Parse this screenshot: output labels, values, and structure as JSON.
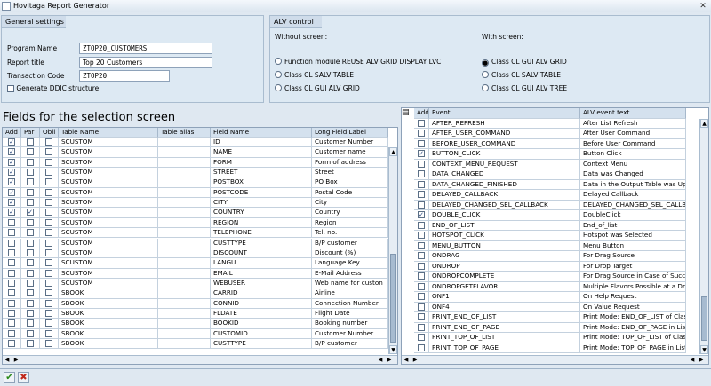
{
  "window": {
    "title": "Hovitaga Report Generator",
    "close": "✕"
  },
  "general": {
    "header": "General settings",
    "program_name_label": "Program Name",
    "program_name_value": "ZTOP20_CUSTOMERS",
    "report_title_label": "Report title",
    "report_title_value": "Top 20 Customers",
    "tcode_label": "Transaction Code",
    "tcode_value": "ZTOP20",
    "ddic_label": "Generate DDIC structure"
  },
  "alv": {
    "header": "ALV control",
    "without_label": "Without screen:",
    "with_label": "With screen:",
    "without_options": [
      "Function module REUSE ALV GRID DISPLAY LVC",
      "Class CL SALV TABLE",
      "Class CL GUI ALV GRID"
    ],
    "with_options": [
      "Class CL GUI ALV GRID",
      "Class CL SALV TABLE",
      "Class CL GUI ALV TREE"
    ],
    "selected": "Class CL GUI ALV GRID"
  },
  "fields": {
    "title": "Fields for the selection screen",
    "columns": [
      "Add",
      "Par",
      "Obli",
      "Table Name",
      "Table alias",
      "Field Name",
      "Long Field Label"
    ],
    "rows": [
      [
        "✓",
        "",
        "",
        "SCUSTOM",
        "",
        "ID",
        "Customer Number"
      ],
      [
        "✓",
        "",
        "",
        "SCUSTOM",
        "",
        "NAME",
        "Customer name"
      ],
      [
        "✓",
        "",
        "",
        "SCUSTOM",
        "",
        "FORM",
        "Form of address"
      ],
      [
        "✓",
        "",
        "",
        "SCUSTOM",
        "",
        "STREET",
        "Street"
      ],
      [
        "✓",
        "",
        "",
        "SCUSTOM",
        "",
        "POSTBOX",
        "PO Box"
      ],
      [
        "✓",
        "",
        "",
        "SCUSTOM",
        "",
        "POSTCODE",
        "Postal Code"
      ],
      [
        "✓",
        "",
        "",
        "SCUSTOM",
        "",
        "CITY",
        "City"
      ],
      [
        "✓",
        "✓",
        "",
        "SCUSTOM",
        "",
        "COUNTRY",
        "Country"
      ],
      [
        "",
        "",
        "",
        "SCUSTOM",
        "",
        "REGION",
        "Region"
      ],
      [
        "",
        "",
        "",
        "SCUSTOM",
        "",
        "TELEPHONE",
        "Tel. no."
      ],
      [
        "",
        "",
        "",
        "SCUSTOM",
        "",
        "CUSTTYPE",
        "B/P customer"
      ],
      [
        "",
        "",
        "",
        "SCUSTOM",
        "",
        "DISCOUNT",
        "Discount (%)"
      ],
      [
        "",
        "",
        "",
        "SCUSTOM",
        "",
        "LANGU",
        "Language Key"
      ],
      [
        "",
        "",
        "",
        "SCUSTOM",
        "",
        "EMAIL",
        "E-Mail Address"
      ],
      [
        "",
        "",
        "",
        "SCUSTOM",
        "",
        "WEBUSER",
        "Web name for custon"
      ],
      [
        "",
        "",
        "",
        "SBOOK",
        "",
        "CARRID",
        "Airline"
      ],
      [
        "",
        "",
        "",
        "SBOOK",
        "",
        "CONNID",
        "Connection Number"
      ],
      [
        "",
        "",
        "",
        "SBOOK",
        "",
        "FLDATE",
        "Flight Date"
      ],
      [
        "",
        "",
        "",
        "SBOOK",
        "",
        "BOOKID",
        "Booking number"
      ],
      [
        "",
        "",
        "",
        "SBOOK",
        "",
        "CUSTOMID",
        "Customer Number"
      ],
      [
        "",
        "",
        "",
        "SBOOK",
        "",
        "CUSTTYPE",
        "B/P customer"
      ]
    ]
  },
  "events": {
    "columns": [
      "Add",
      "Event",
      "ALV event text"
    ],
    "rows": [
      [
        "",
        "AFTER_REFRESH",
        "After List Refresh"
      ],
      [
        "",
        "AFTER_USER_COMMAND",
        "After User Command"
      ],
      [
        "",
        "BEFORE_USER_COMMAND",
        "Before User Command"
      ],
      [
        "✓",
        "BUTTON_CLICK",
        "Button Click"
      ],
      [
        "",
        "CONTEXT_MENU_REQUEST",
        "Context Menu"
      ],
      [
        "",
        "DATA_CHANGED",
        "Data was Changed"
      ],
      [
        "",
        "DATA_CHANGED_FINISHED",
        "Data in the Output Table was Upd"
      ],
      [
        "",
        "DELAYED_CALLBACK",
        "Delayed Callback"
      ],
      [
        "",
        "DELAYED_CHANGED_SEL_CALLBACK",
        "DELAYED_CHANGED_SEL_CALLBAC"
      ],
      [
        "✓",
        "DOUBLE_CLICK",
        "DoubleClick"
      ],
      [
        "",
        "END_OF_LIST",
        "End_of_list"
      ],
      [
        "",
        "HOTSPOT_CLICK",
        "Hotspot was Selected"
      ],
      [
        "",
        "MENU_BUTTON",
        "Menu Button"
      ],
      [
        "",
        "ONDRAG",
        "For Drag Source"
      ],
      [
        "",
        "ONDROP",
        "For Drop Target"
      ],
      [
        "",
        "ONDROPCOMPLETE",
        "For Drag Source in Case of Succe"
      ],
      [
        "",
        "ONDROPGETFLAVOR",
        "Multiple Flavors Possible at a Drop"
      ],
      [
        "",
        "ONF1",
        "On Help Request"
      ],
      [
        "",
        "ONF4",
        "On Value Request"
      ],
      [
        "",
        "PRINT_END_OF_LIST",
        "Print Mode: END_OF_LIST of Clas"
      ],
      [
        "",
        "PRINT_END_OF_PAGE",
        "Print Mode: END_OF_PAGE in List"
      ],
      [
        "",
        "PRINT_TOP_OF_LIST",
        "Print Mode: TOP_OF_LIST of Clas"
      ],
      [
        "",
        "PRINT_TOP_OF_PAGE",
        "Print Mode: TOP_OF_PAGE in List"
      ]
    ]
  },
  "footer": {
    "ok": "✔",
    "cancel": "✖"
  }
}
